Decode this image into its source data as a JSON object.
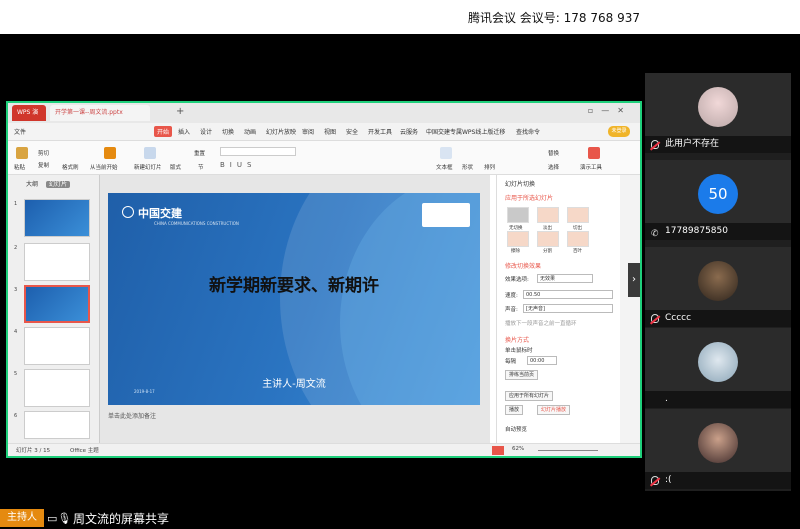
{
  "meeting": {
    "id_label": "腾讯会议 会议号: 178 768 937"
  },
  "wps": {
    "tabs": {
      "app": "WPS 演示",
      "file": "开学第一课--周文流.pptx"
    },
    "new_tab": "+",
    "menu": [
      "文件",
      "开始",
      "插入",
      "设计",
      "切换",
      "动画",
      "幻灯片放映",
      "审阅",
      "视图",
      "安全",
      "开发工具",
      "云服务",
      "中国交建专属WPS线上版迁移",
      "查找命令"
    ],
    "login": "未登录",
    "ribbon": [
      "粘贴",
      "剪切",
      "复制",
      "格式刷",
      "从当前开始",
      "新建幻灯片",
      "版式",
      "重置",
      "节",
      "文本框",
      "形状",
      "排列",
      "替换",
      "选择",
      "演示工具"
    ],
    "left_tabs": {
      "outline": "大纲",
      "slides": "幻灯片"
    },
    "thumb_numbers": [
      "1",
      "2",
      "3",
      "4",
      "5",
      "6"
    ],
    "slide": {
      "logo_text": "中国交建",
      "logo_sub": "CHINA COMMUNICATIONS CONSTRUCTION",
      "title": "新学期新要求、新期许",
      "speaker": "主讲人-周文流",
      "date": "2019-8-17"
    },
    "notes_placeholder": "单击此处添加备注",
    "right_pane": {
      "title": "幻灯片切换",
      "apply_link": "应用于所选幻灯片",
      "effects": [
        "无切换",
        "淡出",
        "切出",
        "擦除",
        "分割",
        "百叶"
      ],
      "modify_link": "修改切换效果",
      "effect_option_label": "效果选项:",
      "effect_option_value": "无效果",
      "speed_label": "速度:",
      "speed_value": "00.50",
      "sound_label": "声音:",
      "sound_value": "[无声音]",
      "loop_label": "播放下一段声音之前一直循环",
      "advance_title": "换片方式",
      "on_click": "单击鼠标时",
      "every_label": "每隔",
      "every_value": "00:00",
      "sequence_btn": "排练当前页",
      "apply_all_btn": "应用于所有幻灯片",
      "play_btn": "播放",
      "slideshow_btn": "幻灯片播放",
      "autopreview": "自动预览"
    },
    "status": {
      "slide_info": "幻灯片 3 / 15",
      "theme": "Office 主题",
      "zoom": "62%"
    }
  },
  "participants": [
    {
      "name": "此用户不存在",
      "avatar": "photo",
      "muted": true
    },
    {
      "name": "17789875850",
      "avatar": "50",
      "muted": false,
      "phone": true
    },
    {
      "name": "Ccccc",
      "avatar": "photo",
      "muted": true
    },
    {
      "name": ".",
      "avatar": "photo",
      "muted": false
    },
    {
      "name": ":(",
      "avatar": "photo",
      "muted": true
    }
  ],
  "bottom": {
    "host_badge": "主持人",
    "share_text": "周文流的屏幕共享"
  },
  "colors": {
    "share_border": "#1fcf7b",
    "host_badge": "#e58a10",
    "wps_red": "#e8564a",
    "avatar_blue": "#1b7bea"
  }
}
